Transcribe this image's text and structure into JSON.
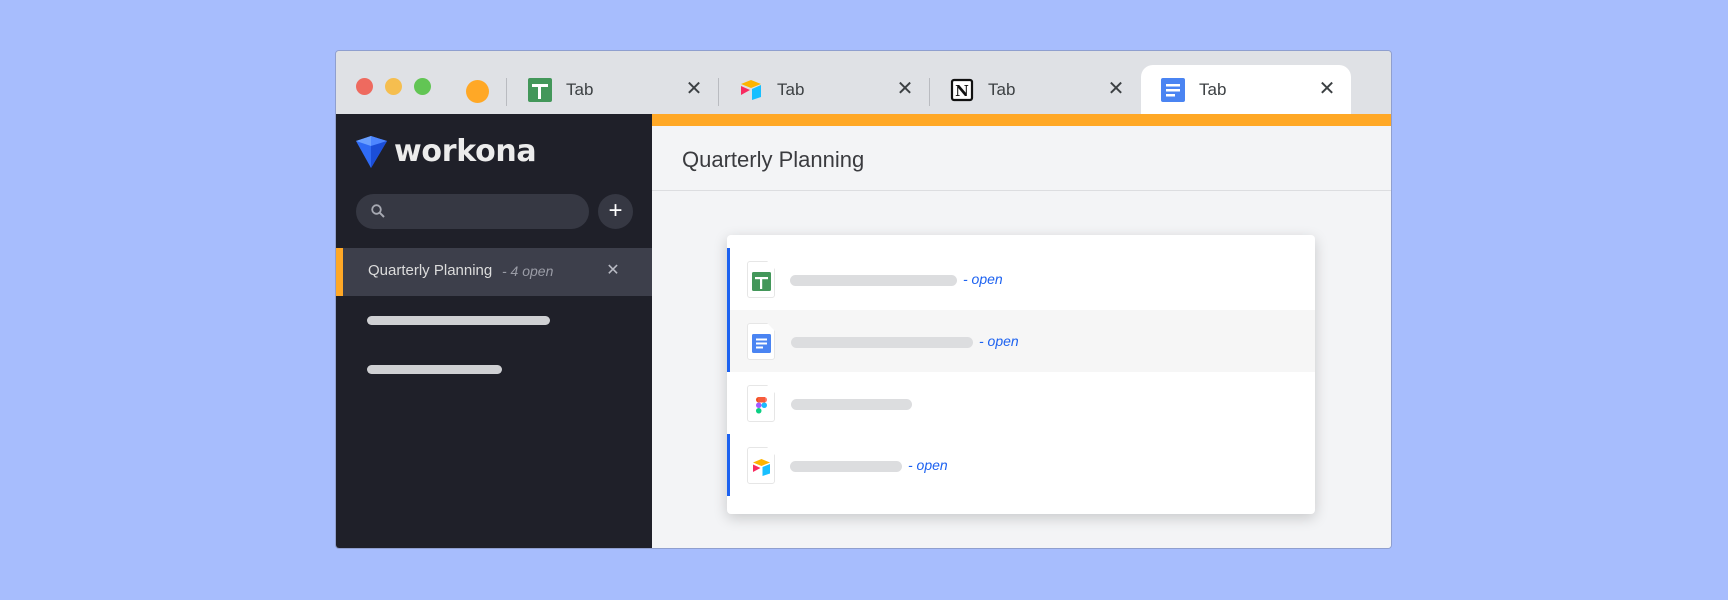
{
  "browser": {
    "traffic_lights": [
      "close",
      "minimize",
      "maximize"
    ],
    "workspace_color": "#ffa826",
    "tabs": [
      {
        "title": "Tab",
        "icon": "google-sheets-icon",
        "active": false
      },
      {
        "title": "Tab",
        "icon": "airtable-icon",
        "active": false
      },
      {
        "title": "Tab",
        "icon": "notion-icon",
        "active": false
      },
      {
        "title": "Tab",
        "icon": "google-docs-icon",
        "active": true
      }
    ],
    "close_glyph": "✕"
  },
  "sidebar": {
    "brand": "workona",
    "search": {
      "value": "",
      "placeholder": ""
    },
    "add_glyph": "+",
    "workspaces": [
      {
        "name": "Quarterly Planning",
        "count_label": "- 4 open",
        "active": true,
        "close_glyph": "✕"
      }
    ],
    "placeholder_items": 2
  },
  "main": {
    "accent_color": "#ffa826",
    "title": "Quarterly Planning",
    "resources": [
      {
        "icon": "google-sheets-icon",
        "open": true,
        "status": "- open",
        "highlighted": false
      },
      {
        "icon": "google-docs-icon",
        "open": true,
        "status": "- open",
        "highlighted": true
      },
      {
        "icon": "figma-icon",
        "open": false,
        "status": "",
        "highlighted": false
      },
      {
        "icon": "airtable-icon",
        "open": true,
        "status": "- open",
        "highlighted": false
      }
    ]
  }
}
